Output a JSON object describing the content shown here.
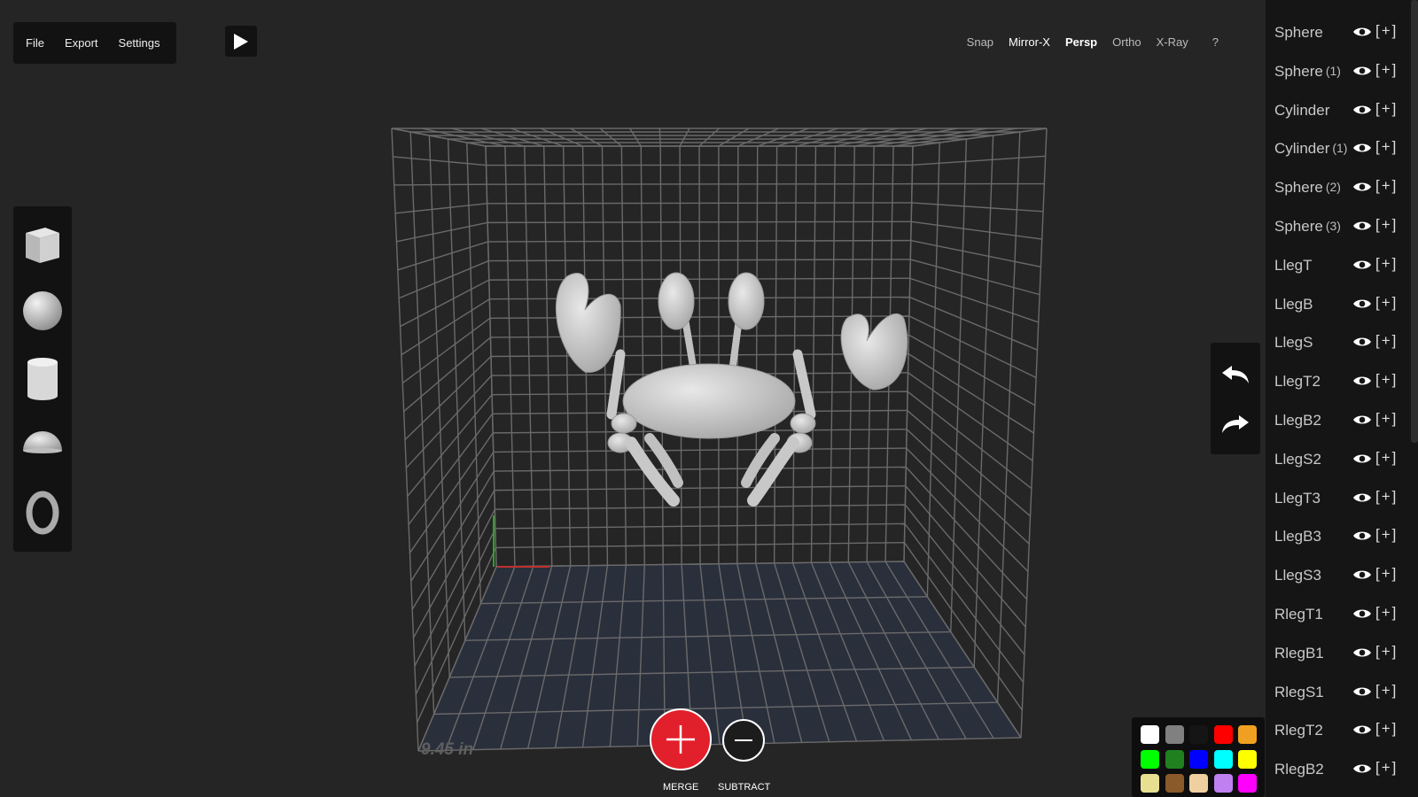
{
  "menu": {
    "file": "File",
    "export": "Export",
    "settings": "Settings"
  },
  "topbar": {
    "snap": "Snap",
    "mirror": "Mirror-X",
    "persp": "Persp",
    "ortho": "Ortho",
    "xray": "X-Ray",
    "help": "?"
  },
  "objects": [
    {
      "name": "Sphere",
      "idx": ""
    },
    {
      "name": "Sphere",
      "idx": "(1)"
    },
    {
      "name": "Cylinder",
      "idx": ""
    },
    {
      "name": "Cylinder",
      "idx": "(1)"
    },
    {
      "name": "Sphere",
      "idx": "(2)"
    },
    {
      "name": "Sphere",
      "idx": "(3)"
    },
    {
      "name": "LlegT",
      "idx": ""
    },
    {
      "name": "LlegB",
      "idx": ""
    },
    {
      "name": "LlegS",
      "idx": ""
    },
    {
      "name": "LlegT2",
      "idx": ""
    },
    {
      "name": "LlegB2",
      "idx": ""
    },
    {
      "name": "LlegS2",
      "idx": ""
    },
    {
      "name": "LlegT3",
      "idx": ""
    },
    {
      "name": "LlegB3",
      "idx": ""
    },
    {
      "name": "LlegS3",
      "idx": ""
    },
    {
      "name": "RlegT1",
      "idx": ""
    },
    {
      "name": "RlegB1",
      "idx": ""
    },
    {
      "name": "RlegS1",
      "idx": ""
    },
    {
      "name": "RlegT2",
      "idx": ""
    },
    {
      "name": "RlegB2",
      "idx": ""
    }
  ],
  "object_add_label": "[+]",
  "palette": [
    "#ffffff",
    "#808080",
    "#151515",
    "#ff0000",
    "#f0a020",
    "#00ff00",
    "#208020",
    "#0000ff",
    "#00ffff",
    "#ffff00",
    "#e8e090",
    "#8a5a2a",
    "#f0d0a0",
    "#c080f0",
    "#ff00ff"
  ],
  "viewport": {
    "dimension_label": "9.45 in"
  },
  "actions": {
    "merge_label": "MERGE",
    "subtract_label": "SUBTRACT"
  },
  "icons": {
    "play": "play-icon",
    "cube": "cube-icon",
    "sphere": "sphere-icon",
    "cylinder": "cylinder-icon",
    "hemisphere": "hemisphere-icon",
    "torus": "torus-icon",
    "undo": "undo-icon",
    "redo": "redo-icon",
    "eye": "eye-icon"
  }
}
